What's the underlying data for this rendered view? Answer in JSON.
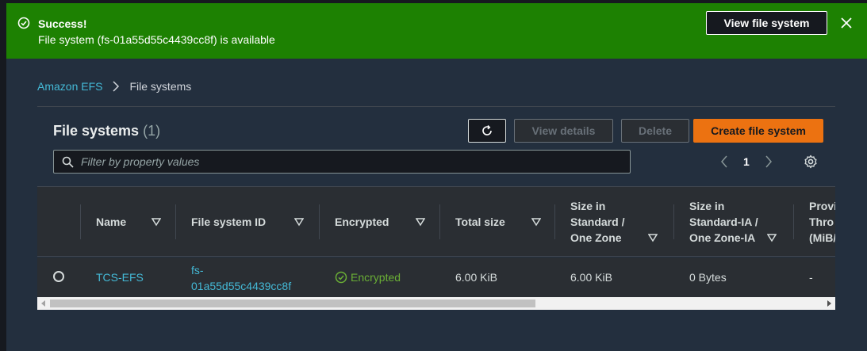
{
  "flash": {
    "title": "Success!",
    "message": "File system (fs-01a55d55c4439cc8f) is available",
    "view_button": "View file system",
    "color": "#1d8102"
  },
  "breadcrumb": {
    "root": "Amazon EFS",
    "current": "File systems"
  },
  "panel": {
    "title": "File systems",
    "count": "(1)",
    "view_details": "View details",
    "delete": "Delete",
    "create": "Create file system",
    "filter_placeholder": "Filter by property values",
    "page": "1",
    "accent": "#ec7211"
  },
  "table": {
    "columns": [
      {
        "line1": "Name",
        "line2": "",
        "line3": ""
      },
      {
        "line1": "File system ID",
        "line2": "",
        "line3": ""
      },
      {
        "line1": "Encrypted",
        "line2": "",
        "line3": ""
      },
      {
        "line1": "Total size",
        "line2": "",
        "line3": ""
      },
      {
        "line1": "Size in",
        "line2": "Standard /",
        "line3": "One Zone"
      },
      {
        "line1": "Size in",
        "line2": "Standard-IA /",
        "line3": "One Zone-IA"
      },
      {
        "line1": "Provi",
        "line2": "Thro",
        "line3": "(MiB/"
      }
    ],
    "rows": [
      {
        "name": "TCS-EFS",
        "id_line1": "fs-",
        "id_line2": "01a55d55c4439cc8f",
        "encrypted": "Encrypted",
        "total_size": "6.00 KiB",
        "size_standard": "6.00 KiB",
        "size_ia": "0 Bytes",
        "provisioned": "-"
      }
    ]
  }
}
